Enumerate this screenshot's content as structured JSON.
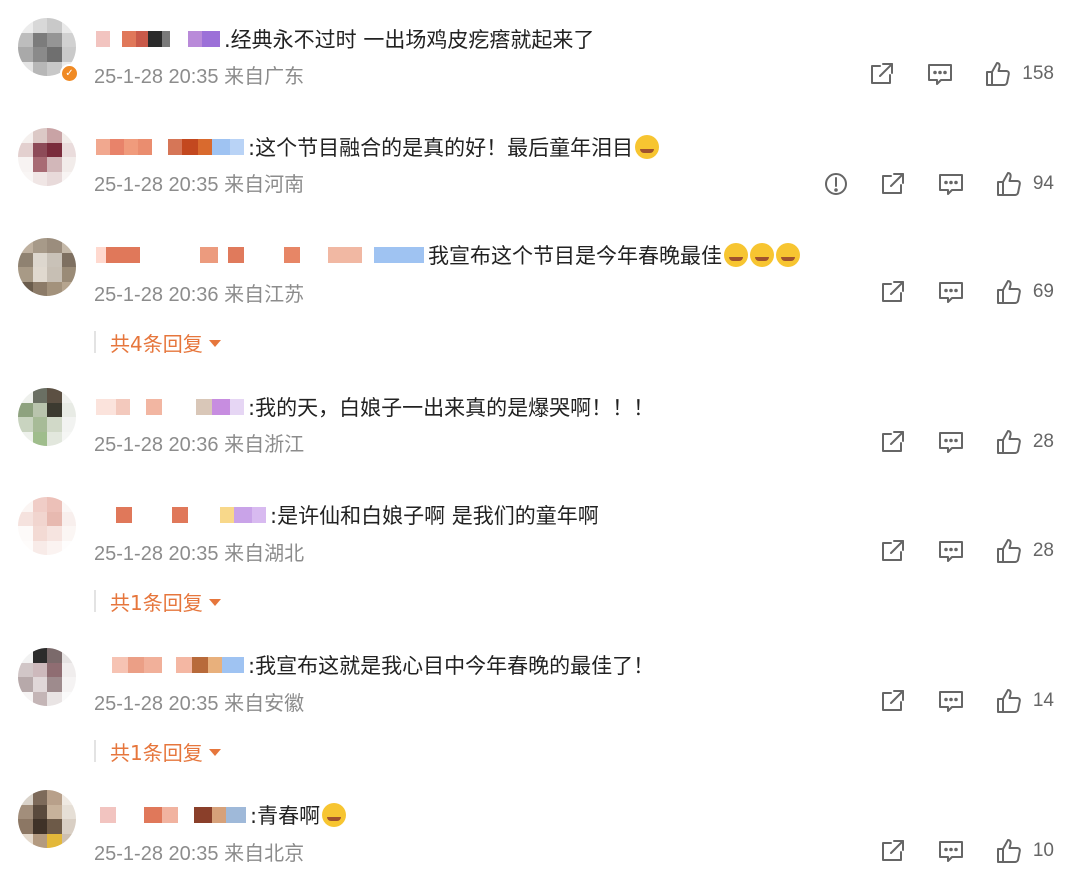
{
  "comments": [
    {
      "text": ".经典永不过时 一出场鸡皮疙瘩就起来了",
      "time": "25-1-28 20:35",
      "location": "来自广东",
      "likes": "158",
      "has_report": false,
      "has_emoji": false,
      "emoji_count": 0,
      "replies": null
    },
    {
      "text": ":这个节目融合的是真的好！最后童年泪目",
      "time": "25-1-28 20:35",
      "location": "来自河南",
      "likes": "94",
      "has_report": true,
      "has_emoji": true,
      "emoji_count": 1,
      "replies": null
    },
    {
      "text": "我宣布这个节目是今年春晚最佳",
      "time": "25-1-28 20:36",
      "location": "来自江苏",
      "likes": "69",
      "has_report": false,
      "has_emoji": true,
      "emoji_count": 3,
      "replies": "共4条回复"
    },
    {
      "text": ":我的天，白娘子一出来真的是爆哭啊！！！",
      "time": "25-1-28 20:36",
      "location": "来自浙江",
      "likes": "28",
      "has_report": false,
      "has_emoji": false,
      "emoji_count": 0,
      "replies": null
    },
    {
      "text": ":是许仙和白娘子啊 是我们的童年啊",
      "time": "25-1-28 20:35",
      "location": "来自湖北",
      "likes": "28",
      "has_report": false,
      "has_emoji": false,
      "emoji_count": 0,
      "replies": "共1条回复"
    },
    {
      "text": ":我宣布这就是我心目中今年春晚的最佳了！",
      "time": "25-1-28 20:35",
      "location": "来自安徽",
      "likes": "14",
      "has_report": false,
      "has_emoji": false,
      "emoji_count": 0,
      "replies": "共1条回复"
    },
    {
      "text": ":青春啊",
      "time": "25-1-28 20:35",
      "location": "来自北京",
      "likes": "10",
      "has_report": false,
      "has_emoji": true,
      "emoji_count": 1,
      "replies": null
    }
  ],
  "colors": {
    "accent": "#e6763c",
    "meta": "#8c8c8c",
    "icon": "#666666",
    "verified_badge": "#f08a24"
  },
  "icons": {
    "repost": "share-icon",
    "comment": "comment-icon",
    "like": "thumbs-up-icon",
    "report": "report-icon",
    "expand": "caret-down-icon"
  }
}
